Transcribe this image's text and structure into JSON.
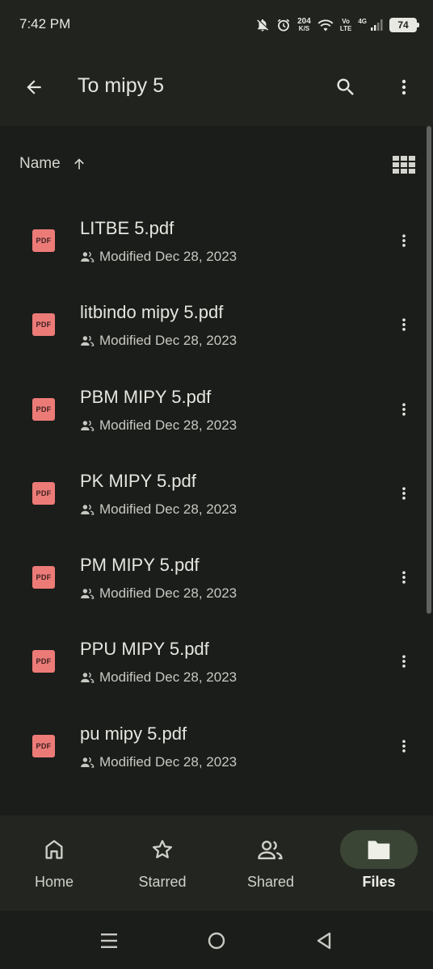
{
  "status_bar": {
    "time": "7:42 PM",
    "net_speed_value": "204",
    "net_speed_unit": "K/S",
    "volte_top": "Vo",
    "volte_bottom": "LTE",
    "network": "4G",
    "battery": "74",
    "icons": [
      "bell-off-icon",
      "alarm-icon",
      "wifi-icon",
      "signal-icon",
      "battery-icon"
    ]
  },
  "app_bar": {
    "title": "To mipy 5",
    "icons": [
      "back-arrow-icon",
      "search-icon",
      "more-vert-icon"
    ]
  },
  "sort": {
    "label": "Name",
    "direction": "ascending",
    "view_icon": "grid-view-icon"
  },
  "files": [
    {
      "name": "LITBE 5.pdf",
      "type_label": "PDF",
      "meta": "Modified Dec 28, 2023"
    },
    {
      "name": "litbindo mipy 5.pdf",
      "type_label": "PDF",
      "meta": "Modified Dec 28, 2023"
    },
    {
      "name": "PBM MIPY 5.pdf",
      "type_label": "PDF",
      "meta": "Modified Dec 28, 2023"
    },
    {
      "name": "PK MIPY 5.pdf",
      "type_label": "PDF",
      "meta": "Modified Dec 28, 2023"
    },
    {
      "name": "PM MIPY 5.pdf",
      "type_label": "PDF",
      "meta": "Modified Dec 28, 2023"
    },
    {
      "name": "PPU MIPY 5.pdf",
      "type_label": "PDF",
      "meta": "Modified Dec 28, 2023"
    },
    {
      "name": "pu mipy 5.pdf",
      "type_label": "PDF",
      "meta": "Modified Dec 28, 2023"
    }
  ],
  "bottom_nav": [
    {
      "label": "Home",
      "icon": "home-icon",
      "active": false
    },
    {
      "label": "Starred",
      "icon": "star-icon",
      "active": false
    },
    {
      "label": "Shared",
      "icon": "shared-icon",
      "active": false
    },
    {
      "label": "Files",
      "icon": "folder-icon",
      "active": true
    }
  ],
  "system_nav": [
    "menu-icon",
    "home-circle-icon",
    "back-triangle-icon"
  ],
  "colors": {
    "background": "#1b1d1a",
    "app_bar": "#20231e",
    "pdf_badge": "#ec7b78",
    "active_nav_pill": "#3b4536",
    "text": "#e6e6e0"
  }
}
